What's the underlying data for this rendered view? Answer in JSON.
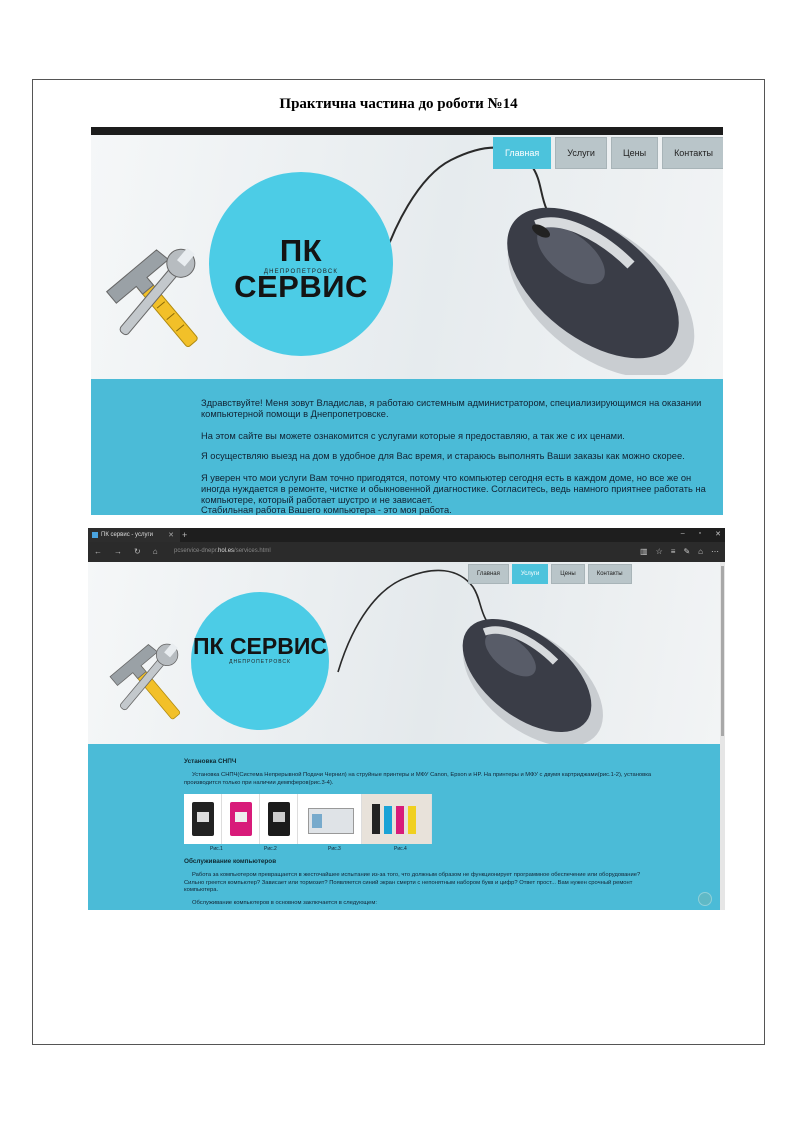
{
  "doc": {
    "title": "Практична частина до роботи №14"
  },
  "site": {
    "nav": [
      "Главная",
      "Услуги",
      "Цены",
      "Контакты"
    ],
    "brand": "ПК СЕРВИС",
    "city": "ДНЕПРОПЕТРОВСК"
  },
  "shot1": {
    "active_nav": "Главная",
    "paragraphs": [
      "Здравствуйте! Меня зовут Владислав, я работаю системным администратором, специализирующимся на оказании компьютерной помощи в Днепропетровске.",
      "На этом сайте вы можете ознакомится с услугами которые я предоставляю, а так же с их ценами.",
      "Я осуществляю выезд на дом в удобное для Вас время, и стараюсь выполнять Ваши заказы как можно скорее.",
      "Я уверен что мои услуги Вам точно пригодятся, потому что компьютер сегодня есть в каждом доме, но все же он иногда нуждается в ремонте, чистке и обыкновенной диагностике. Согласитесь, ведь намного приятнее работать на компьютере, который работает шустро и не зависает.",
      "Стабильная работа Вашего компьютера - это моя работа."
    ]
  },
  "shot2": {
    "browser": {
      "tab_title": "ПК сервис - услуги",
      "url_prefix": "pcservice-dnepr.",
      "url_host": "hol.es",
      "url_path": "/services.html"
    },
    "active_nav": "Услуги",
    "section1_title": "Установка СНПЧ",
    "section1_text": "Установка СНПЧ(Система Непрерывной Подачи Чернил) на струйные принтеры и МФУ Canon, Epson и HP. На принтеры и МФУ с двумя картриджами(рис.1-2), установка производится только при наличии демпферов(рис.3-4).",
    "captions": [
      "Рис.1",
      "Рис.2",
      "Рис.3",
      "Рис.4"
    ],
    "section2_title": "Обслуживание компьютеров",
    "section2_text": "Работа за компьютером превращается в жесточайшее испытание из-за того, что должным образом не функционирует программное обеспечение или оборудование? Сильно греется компьютер? Зависает или тормозит? Появляется синий экран смерти с непонятным набором букв и цифр? Ответ прост... Вам нужен срочный ремонт компьютера.",
    "section2_more": "Обслуживание компьютеров в основном заключается в следующем:"
  },
  "colors": {
    "accent": "#4cc3dc",
    "content_bg": "#4bbbd7"
  }
}
